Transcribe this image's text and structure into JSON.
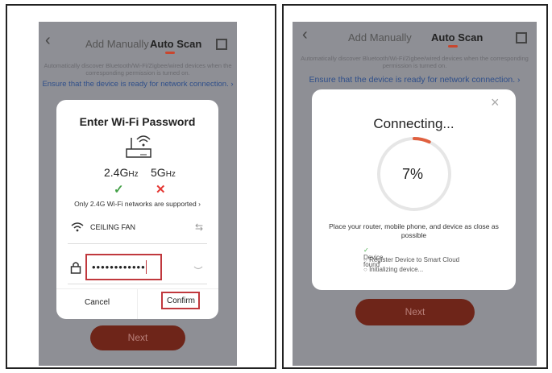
{
  "left": {
    "topbar": {
      "back": "‹",
      "add_manually": "Add Manually",
      "auto_scan": "Auto Scan"
    },
    "hint": "Automatically discover Bluetooth/Wi-Fi/Zigbee/wired devices when the corresponding permission is turned on.",
    "ensure": "Ensure that the device is ready for network connection. ›",
    "modal": {
      "title": "Enter Wi-Fi Password",
      "band_24": "2.4G",
      "band_24_unit": "Hz",
      "band_5": "5G",
      "band_5_unit": "Hz",
      "check": "✓",
      "cross": "✕",
      "supported": "Only 2.4G Wi-Fi networks are supported ›",
      "ssid": "CEILING FAN",
      "swap": "⇆",
      "password": "••••••••••••",
      "cancel": "Cancel",
      "confirm": "Confirm"
    },
    "next": "Next"
  },
  "right": {
    "topbar": {
      "back": "‹",
      "add_manually": "Add Manually",
      "auto_scan": "Auto Scan"
    },
    "hint": "Automatically discover Bluetooth/Wi-Fi/Zigbee/wired devices when the corresponding permission is turned on.",
    "ensure": "Ensure that the device is ready for network connection. ›",
    "modal": {
      "close": "×",
      "title": "Connecting...",
      "percent": "7%",
      "progress": 0.07,
      "advice": "Place your router, mobile phone, and device as close as possible",
      "steps": [
        {
          "mark": "✓",
          "label": "Device found"
        },
        {
          "mark": "○",
          "label": "Register Device to Smart Cloud"
        },
        {
          "mark": "○",
          "label": "Initializing device..."
        }
      ]
    },
    "next": "Next"
  },
  "colors": {
    "accent": "#c9462e",
    "highlight_border": "#c0383d",
    "next_button": "#6e2519",
    "overlay": "#8e8f95"
  }
}
